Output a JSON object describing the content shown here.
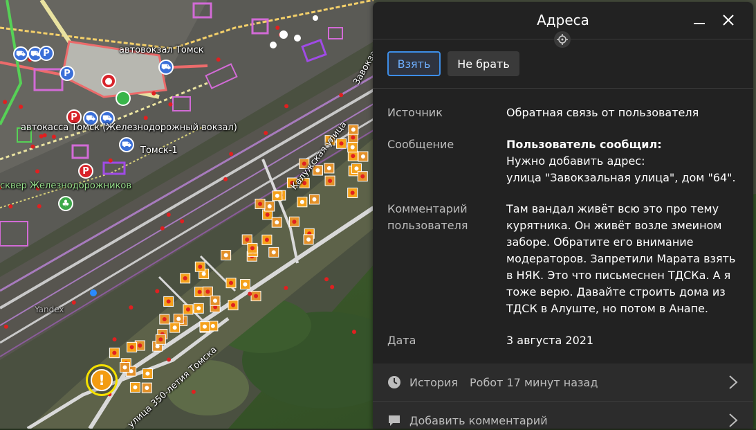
{
  "map": {
    "labels": {
      "bus_station": "автовокзал Томск",
      "ticket_office": "автокасса Томск (Железнодорожный вокзал)",
      "station": "Томск-1",
      "square": "сквер Железнодорожников",
      "kaluzhskaya": "Калужская улица",
      "street350": "улица 350-летия Томска",
      "zavokz": "Завокзальная",
      "watermark": "Yandex"
    },
    "poi": {
      "parking": "P",
      "alert": "!"
    }
  },
  "panel": {
    "title": "Адреса",
    "take_label": "Взять",
    "skip_label": "Не брать",
    "rows": {
      "source": {
        "label": "Источник",
        "value": "Обратная связь от пользователя"
      },
      "message": {
        "label": "Сообщение",
        "line1": "Пользователь сообщил:",
        "line2": "Нужно добавить адрес:",
        "line3": "улица \"Завокзальная улица\", дом \"64\"."
      },
      "comment": {
        "label1": "Комментарий",
        "label2": "пользователя",
        "value": "Там вандал живёт всю это про тему курятника. Он живёт возле змеином заборе. Обратите его внимание модераторов. Запретили Марата взять в НЯК. Это что письмеснен ТДСКа. А я тоже верю. Давайте строить дома из ТДСК в Алуште, но потом в Анапе."
      },
      "date": {
        "label": "Дата",
        "value": "3 августа 2021"
      }
    },
    "history": {
      "label": "История",
      "value": "Робот 17 минут назад"
    },
    "add_comment": {
      "label": "Добавить комментарий"
    }
  },
  "colors": {
    "accent": "#3d8ee8",
    "panel_bg": "#222222",
    "alert": "#f39c12",
    "alert_ring": "#f5e100"
  }
}
